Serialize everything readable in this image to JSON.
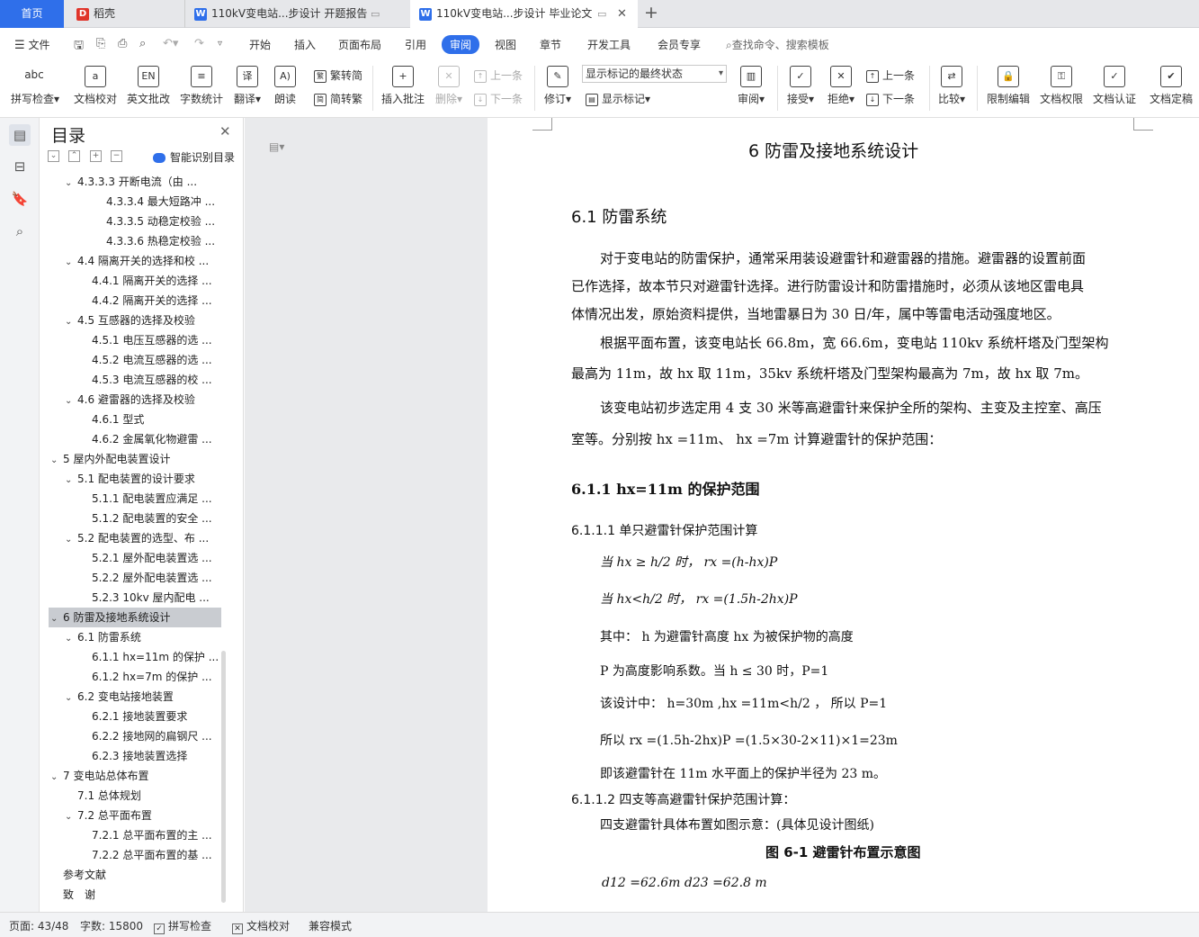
{
  "tabs": {
    "home": "首页",
    "daoke": "稻壳",
    "doc1": "110kV变电站...步设计 开题报告",
    "doc2": "110kV变电站...步设计 毕业论文",
    "new_tab": "+"
  },
  "menu": {
    "file": "文件",
    "items": [
      "开始",
      "插入",
      "页面布局",
      "引用",
      "审阅",
      "视图",
      "章节",
      "开发工具",
      "会员专享"
    ],
    "active": "审阅",
    "search_placeholder": "查找命令、搜索模板"
  },
  "ribbon": {
    "spell_check": "拼写检查",
    "doc_proof": "文档校对",
    "english_correct": "英文批改",
    "word_count": "字数统计",
    "translate": "翻译",
    "read_aloud": "朗读",
    "trad_to_simp": "繁转简",
    "simp_to_trad": "简转繁",
    "insert_comment": "插入批注",
    "delete": "删除",
    "prev_comment": "上一条",
    "next_comment": "下一条",
    "track_changes": "修订",
    "markup_mode": "显示标记的最终状态",
    "show_markup": "显示标记",
    "review": "审阅",
    "accept": "接受",
    "reject": "拒绝",
    "prev_change": "上一条",
    "next_change": "下一条",
    "compare": "比较",
    "restrict_edit": "限制编辑",
    "doc_permission": "文档权限",
    "doc_certify": "文档认证",
    "doc_finalize": "文档定稿",
    "abc": "abc"
  },
  "toc": {
    "title": "目录",
    "smart_toc": "智能识别目录",
    "items": [
      {
        "text": "4.3.3.3 开断电流（由 ...",
        "level": 3,
        "chev": "down"
      },
      {
        "text": "4.3.3.4 最大短路冲 ...",
        "level": 4
      },
      {
        "text": "4.3.3.5 动稳定校验 ...",
        "level": 4
      },
      {
        "text": "4.3.3.6 热稳定校验 ...",
        "level": 4
      },
      {
        "text": "4.4 隔离开关的选择和校 ...",
        "level": 1,
        "chev": "down"
      },
      {
        "text": "4.4.1 隔离开关的选择 ...",
        "level": 2
      },
      {
        "text": "4.4.2 隔离开关的选择 ...",
        "level": 2
      },
      {
        "text": "4.5 互感器的选择及校验",
        "level": 1,
        "chev": "down"
      },
      {
        "text": "4.5.1 电压互感器的选 ...",
        "level": 2
      },
      {
        "text": "4.5.2 电流互感器的选 ...",
        "level": 2
      },
      {
        "text": "4.5.3 电流互感器的校 ...",
        "level": 2
      },
      {
        "text": "4.6 避雷器的选择及校验",
        "level": 1,
        "chev": "down"
      },
      {
        "text": "4.6.1 型式",
        "level": 2
      },
      {
        "text": "4.6.2 金属氧化物避雷 ...",
        "level": 2
      },
      {
        "text": "5 屋内外配电装置设计",
        "level": 0,
        "chev": "down"
      },
      {
        "text": "5.1 配电装置的设计要求",
        "level": 1,
        "chev": "down"
      },
      {
        "text": "5.1.1 配电装置应满足 ...",
        "level": 2
      },
      {
        "text": "5.1.2 配电装置的安全 ...",
        "level": 2
      },
      {
        "text": "5.2 配电装置的选型、布 ...",
        "level": 1,
        "chev": "down"
      },
      {
        "text": "5.2.1 屋外配电装置选 ...",
        "level": 2
      },
      {
        "text": "5.2.2 屋外配电装置选 ...",
        "level": 2
      },
      {
        "text": "5.2.3 10kv 屋内配电 ...",
        "level": 2
      },
      {
        "text": "6 防雷及接地系统设计",
        "level": 0,
        "chev": "down",
        "selected": true
      },
      {
        "text": "6.1 防雷系统",
        "level": 1,
        "chev": "down"
      },
      {
        "text": "6.1.1 hx=11m 的保护 ...",
        "level": 2
      },
      {
        "text": "6.1.2 hx=7m 的保护 ...",
        "level": 2
      },
      {
        "text": "6.2 变电站接地装置",
        "level": 1,
        "chev": "down"
      },
      {
        "text": "6.2.1 接地装置要求",
        "level": 2
      },
      {
        "text": "6.2.2 接地网的扁钢尺 ...",
        "level": 2
      },
      {
        "text": "6.2.3 接地装置选择",
        "level": 2
      },
      {
        "text": "7 变电站总体布置",
        "level": 0,
        "chev": "down"
      },
      {
        "text": "7.1 总体规划",
        "level": 1
      },
      {
        "text": "7.2 总平面布置",
        "level": 1,
        "chev": "down"
      },
      {
        "text": "7.2.1 总平面布置的主 ...",
        "level": 2
      },
      {
        "text": "7.2.2 总平面布置的基 ...",
        "level": 2
      },
      {
        "text": "参考文献",
        "level": 0
      },
      {
        "text": "致　谢",
        "level": 0
      }
    ]
  },
  "doc": {
    "chapter": "6  防雷及接地系统设计",
    "sec_6_1": "6.1  防雷系统",
    "p1_l1": "对于变电站的防雷保护，通常采用装设避雷针和避雷器的措施。避雷器的设置前面",
    "p1_l2": "已作选择，故本节只对避雷针选择。进行防雷设计和防雷措施时，必须从该地区雷电具",
    "p1_l3": "体情况出发，原始资料提供，当地雷暴日为 30 日/年，属中等雷电活动强度地区。",
    "p2_l1": "根据平面布置，该变电站长 66.8m，宽 66.6m，变电站 110kv 系统杆塔及门型架构",
    "p2_l2": "最高为 11m，故 hx 取 11m，35kv 系统杆塔及门型架构最高为 7m，故 hx 取 7m。",
    "p3_l1": "该变电站初步选定用 4 支 30 米等高避雷针来保护全所的架构、主变及主控室、高压",
    "p3_l2": "室等。分别按 hx =11m、 hx =7m 计算避雷针的保护范围：",
    "sec_6_1_1": "6.1.1 hx=11m 的保护范围",
    "sec_6_1_1_1": "6.1.1.1  单只避雷针保护范围计算",
    "eq1": "当 hx ≥ h/2 时，  rx =(h-hx)P",
    "eq2": "当 hx<h/2 时，  rx =(1.5h-2hx)P",
    "eq3": "其中：  h 为避雷针高度       hx 为被保护物的高度",
    "eq4": "P 为高度影响系数。当 h ≤ 30 时，P=1",
    "eq5": "该设计中：  h=30m ,hx =11m<h/2 ，   所以 P=1",
    "eq6": "所以 rx =(1.5h-2hx)P =(1.5×30-2×11)×1=23m",
    "eq7": "即该避雷针在 11m 水平面上的保护半径为 23 m。",
    "sec_6_1_1_2": "6.1.1.2  四支等高避雷针保护范围计算：",
    "p4": "四支避雷针具体布置如图示意：(具体见设计图纸)",
    "fig_caption": "图 6-1  避雷针布置示意图",
    "eq8": "d12 =62.6m  d23 =62.8 m"
  },
  "status": {
    "page": "页面: 43/48",
    "words": "字数: 15800",
    "spell": "拼写检查",
    "proof": "文档校对",
    "compat": "兼容模式"
  }
}
